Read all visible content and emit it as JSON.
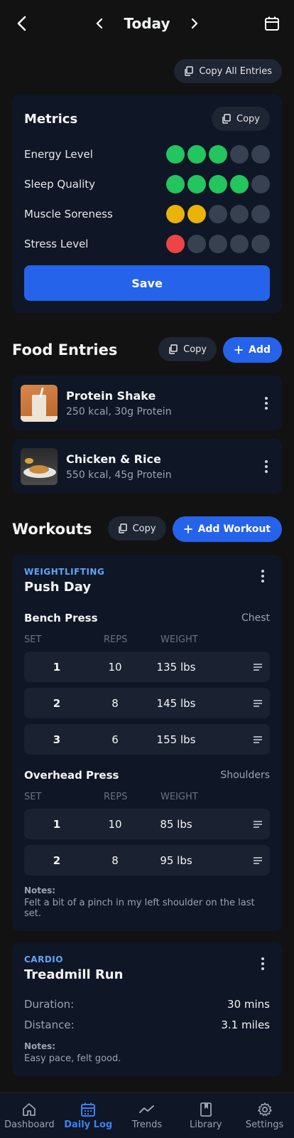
{
  "header": {
    "title": "Today"
  },
  "copy_all_label": "Copy All Entries",
  "metrics": {
    "title": "Metrics",
    "copy_label": "Copy",
    "save_label": "Save",
    "items": [
      {
        "label": "Energy Level",
        "level": 3,
        "color": "#22c55e"
      },
      {
        "label": "Sleep Quality",
        "level": 4,
        "color": "#22c55e"
      },
      {
        "label": "Muscle Soreness",
        "level": 2,
        "color": "#eab308"
      },
      {
        "label": "Stress Level",
        "level": 1,
        "color": "#ef4444"
      }
    ],
    "max_level": 5
  },
  "food": {
    "title": "Food Entries",
    "copy_label": "Copy",
    "add_label": "Add",
    "items": [
      {
        "name": "Protein Shake",
        "meta": "250 kcal, 30g Protein"
      },
      {
        "name": "Chicken & Rice",
        "meta": "550 kcal, 45g Protein"
      }
    ]
  },
  "workouts": {
    "title": "Workouts",
    "copy_label": "Copy",
    "add_label": "Add Workout",
    "lift": {
      "type": "WEIGHTLIFTING",
      "name": "Push Day",
      "columns": {
        "set": "SET",
        "reps": "REPS",
        "weight": "WEIGHT"
      },
      "exercises": [
        {
          "name": "Bench Press",
          "muscle": "Chest",
          "sets": [
            {
              "set": "1",
              "reps": "10",
              "weight": "135 lbs"
            },
            {
              "set": "2",
              "reps": "8",
              "weight": "145 lbs"
            },
            {
              "set": "3",
              "reps": "6",
              "weight": "155 lbs"
            }
          ]
        },
        {
          "name": "Overhead Press",
          "muscle": "Shoulders",
          "sets": [
            {
              "set": "1",
              "reps": "10",
              "weight": "85 lbs"
            },
            {
              "set": "2",
              "reps": "8",
              "weight": "95 lbs"
            }
          ]
        }
      ],
      "notes_label": "Notes:",
      "notes": "Felt a bit of a pinch in my left shoulder on the last set."
    },
    "cardio": {
      "type": "CARDIO",
      "name": "Treadmill Run",
      "duration_label": "Duration:",
      "duration": "30 mins",
      "distance_label": "Distance:",
      "distance": "3.1 miles",
      "notes_label": "Notes:",
      "notes": "Easy pace, felt good."
    }
  },
  "nav": {
    "items": [
      {
        "label": "Dashboard",
        "icon": "home-icon"
      },
      {
        "label": "Daily Log",
        "icon": "calendar-icon",
        "active": true
      },
      {
        "label": "Trends",
        "icon": "trend-icon"
      },
      {
        "label": "Library",
        "icon": "book-icon"
      },
      {
        "label": "Settings",
        "icon": "gear-icon"
      }
    ]
  }
}
